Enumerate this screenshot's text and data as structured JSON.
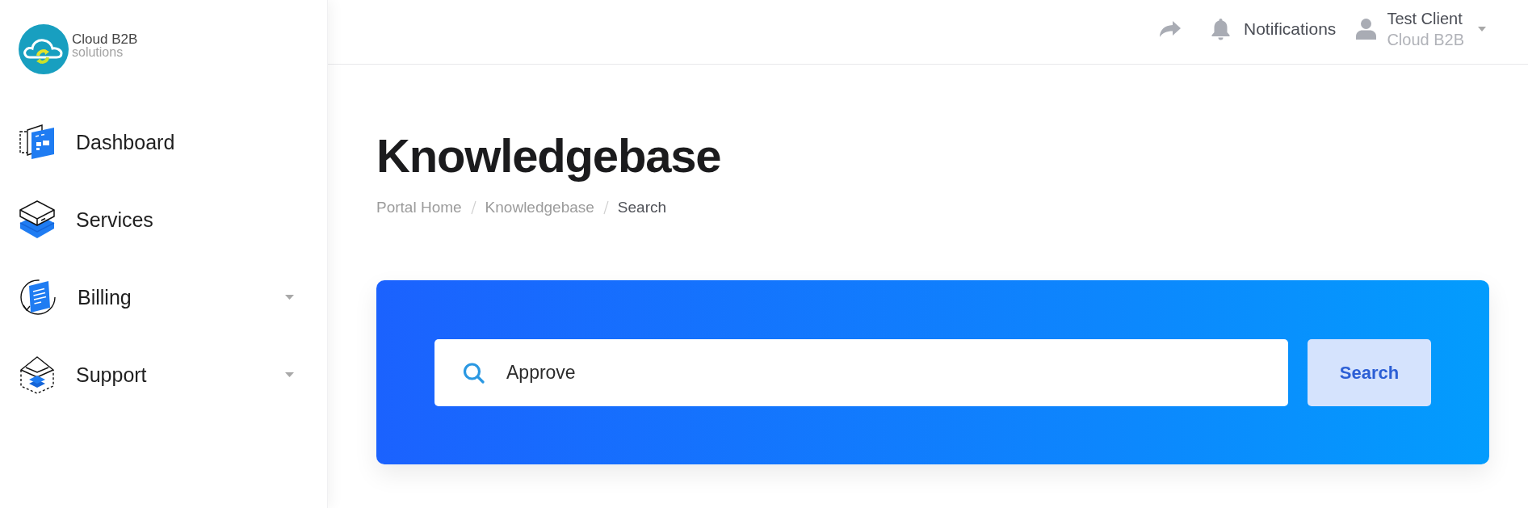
{
  "logo": {
    "name": "Cloud B2B",
    "tagline": "solutions"
  },
  "sidebar": {
    "items": [
      {
        "label": "Dashboard",
        "has_submenu": false
      },
      {
        "label": "Services",
        "has_submenu": false
      },
      {
        "label": "Billing",
        "has_submenu": true
      },
      {
        "label": "Support",
        "has_submenu": true
      }
    ]
  },
  "top_bar": {
    "notifications": {
      "label": "Notifications"
    },
    "user": {
      "name": "Test Client",
      "company": "Cloud B2B"
    }
  },
  "page": {
    "title": "Knowledgebase",
    "breadcrumb": [
      {
        "label": "Portal Home",
        "current": false
      },
      {
        "label": "Knowledgebase",
        "current": false
      },
      {
        "label": "Search",
        "current": true
      }
    ]
  },
  "search": {
    "value": "Approve",
    "button": "Search"
  }
}
